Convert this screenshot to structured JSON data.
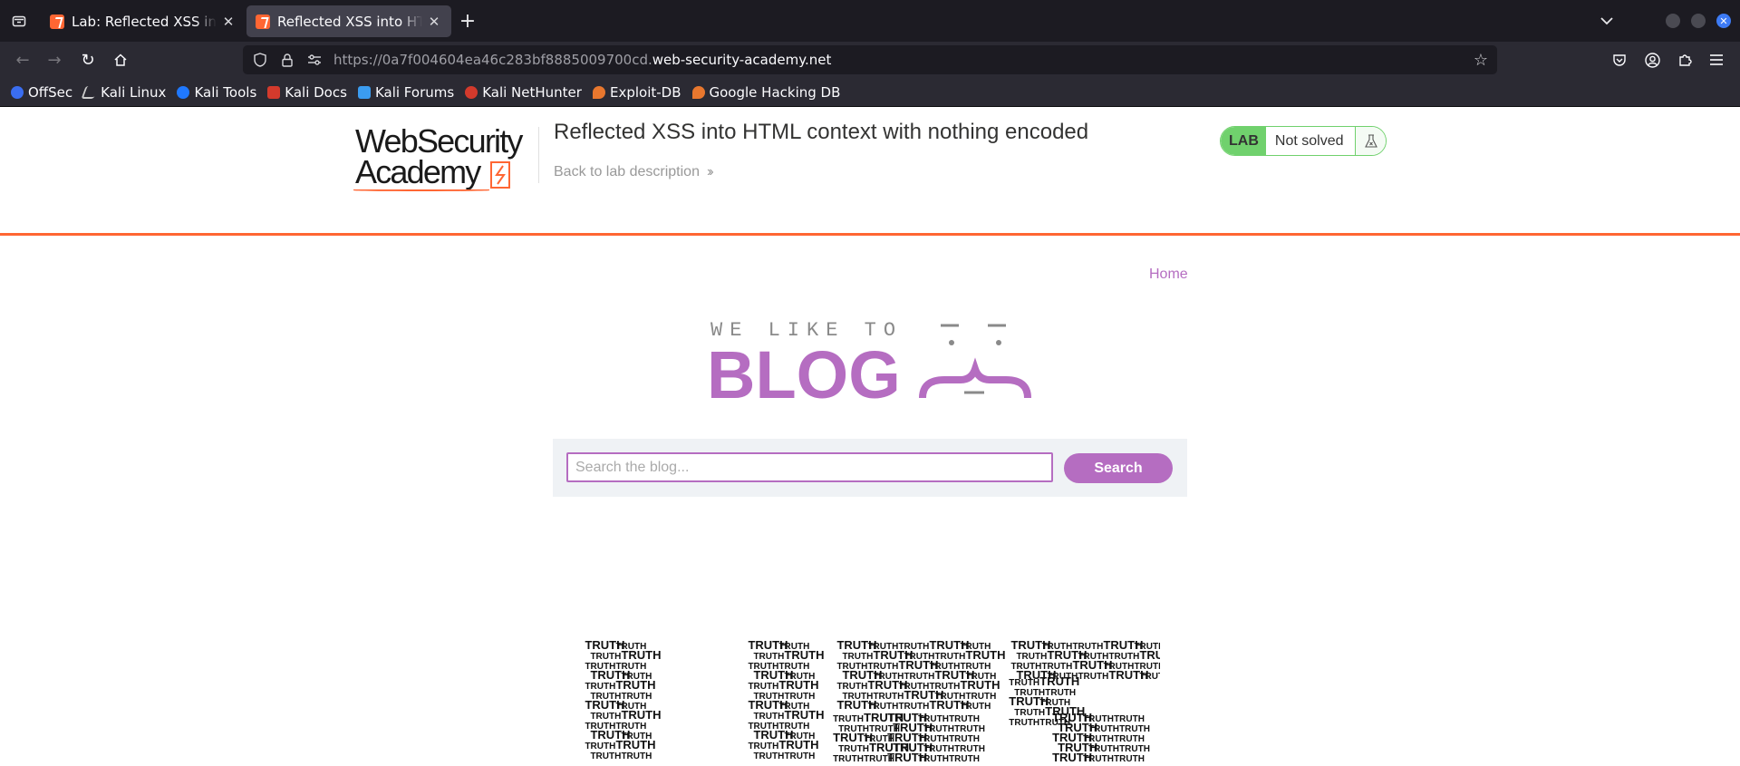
{
  "browser": {
    "tabs": [
      {
        "title": "Lab: Reflected XSS into HTML context with nothing encoded",
        "active": false
      },
      {
        "title": "Reflected XSS into HTML context with nothing encoded",
        "active": true
      }
    ],
    "url_host_prefix": "https://0a7f004604ea46c283bf8885009700cd.",
    "url_domain": "web-security-academy.net",
    "bookmarks": [
      {
        "label": "OffSec",
        "icon": "offsec-icon",
        "color": "#3a6df0"
      },
      {
        "label": "Kali Linux",
        "icon": "kali-dragon-icon",
        "color": "#cccccc"
      },
      {
        "label": "Kali Tools",
        "icon": "kali-tools-icon",
        "color": "#1f78ff"
      },
      {
        "label": "Kali Docs",
        "icon": "kali-docs-icon",
        "color": "#d33a2c"
      },
      {
        "label": "Kali Forums",
        "icon": "kali-forums-icon",
        "color": "#3b9cf0"
      },
      {
        "label": "Kali NetHunter",
        "icon": "kali-nethunter-icon",
        "color": "#d33a2c"
      },
      {
        "label": "Exploit-DB",
        "icon": "exploit-db-icon",
        "color": "#e8772e"
      },
      {
        "label": "Google Hacking DB",
        "icon": "ghdb-icon",
        "color": "#e8772e"
      }
    ]
  },
  "lab": {
    "logo_line1": "WebSecurity",
    "logo_line2": "Academy",
    "title": "Reflected XSS into HTML context with nothing encoded",
    "back_link": "Back to lab description",
    "badge": "LAB",
    "status": "Not solved",
    "accent": "#ff6633",
    "status_color": "#70d16d"
  },
  "blog": {
    "nav_home": "Home",
    "logo_tagline": "WE LIKE TO",
    "logo_word": "BLOG",
    "search_placeholder": "Search the blog...",
    "search_value": "",
    "search_button": "Search",
    "brand_color": "#b56dc1",
    "image_word": "TRUTH"
  }
}
